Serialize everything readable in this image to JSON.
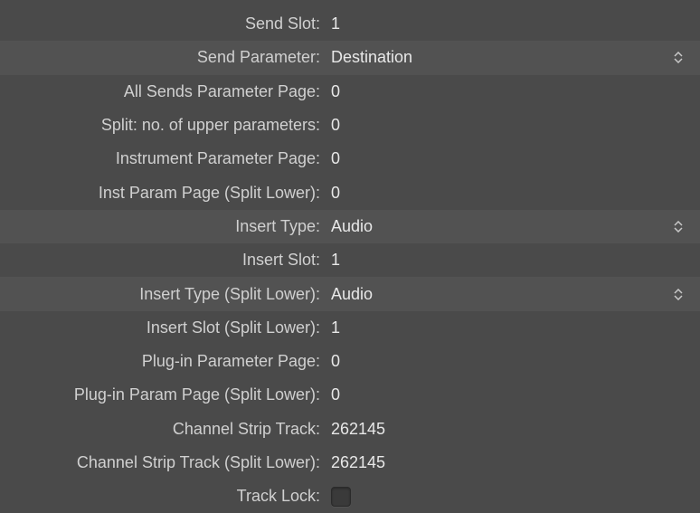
{
  "params": {
    "send_slot": {
      "label": "Send Slot:",
      "value": "1"
    },
    "send_parameter": {
      "label": "Send Parameter:",
      "value": "Destination"
    },
    "all_sends_page": {
      "label": "All Sends Parameter Page:",
      "value": "0"
    },
    "split_upper": {
      "label": "Split: no. of upper parameters:",
      "value": "0"
    },
    "instrument_page": {
      "label": "Instrument Parameter Page:",
      "value": "0"
    },
    "inst_page_split": {
      "label": "Inst Param Page (Split Lower):",
      "value": "0"
    },
    "insert_type": {
      "label": "Insert Type:",
      "value": "Audio"
    },
    "insert_slot": {
      "label": "Insert Slot:",
      "value": "1"
    },
    "insert_type_split": {
      "label": "Insert Type (Split Lower):",
      "value": "Audio"
    },
    "insert_slot_split": {
      "label": "Insert Slot (Split Lower):",
      "value": "1"
    },
    "plugin_page": {
      "label": "Plug-in Parameter Page:",
      "value": "0"
    },
    "plugin_page_split": {
      "label": "Plug-in Param Page (Split Lower):",
      "value": "0"
    },
    "channel_strip": {
      "label": "Channel Strip Track:",
      "value": "262145"
    },
    "channel_strip_split": {
      "label": "Channel Strip Track (Split Lower):",
      "value": "262145"
    },
    "track_lock": {
      "label": "Track Lock:"
    }
  }
}
